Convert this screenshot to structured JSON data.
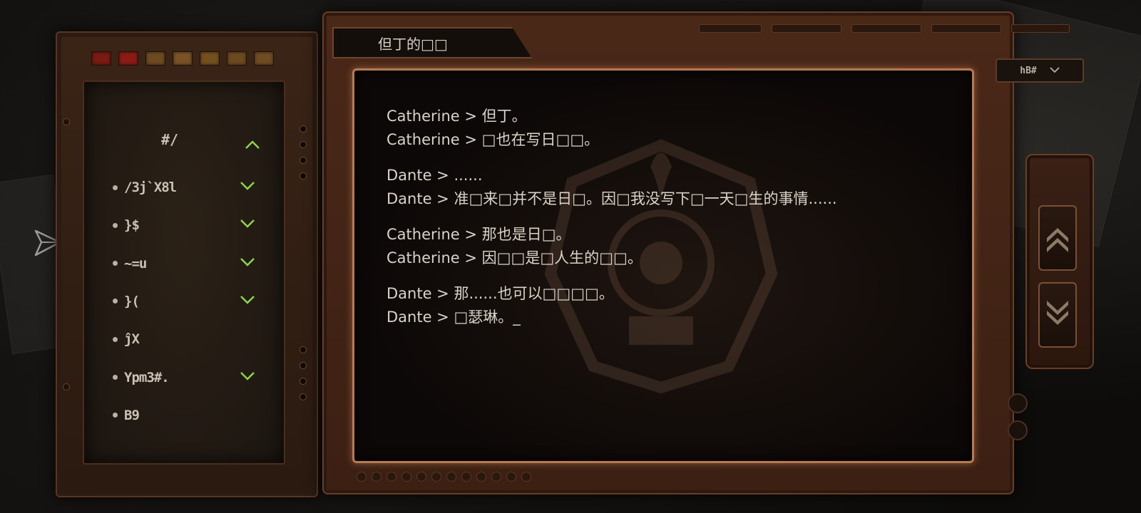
{
  "left_panel": {
    "header": "#/",
    "lights": [
      "#7a1a12",
      "#8a1c14",
      "#6e4a22",
      "#7a5226",
      "#74501f",
      "#6c4a20",
      "#6f4c22"
    ],
    "items": [
      {
        "label": "/3j`X8l",
        "has_chevron": true
      },
      {
        "label": "}$",
        "has_chevron": true
      },
      {
        "label": "~=u",
        "has_chevron": true
      },
      {
        "label": "}(",
        "has_chevron": true
      },
      {
        "label": "ĵX",
        "has_chevron": false
      },
      {
        "label": "Ypm3#.",
        "has_chevron": true
      },
      {
        "label": "B9",
        "has_chevron": false
      }
    ]
  },
  "main_panel": {
    "title": "但丁的□□",
    "dropdown_value": "hB#",
    "dialogue": [
      [
        "Catherine > 但丁。",
        "Catherine > □也在写日□□。"
      ],
      [
        "Dante > ......",
        "Dante > 准□来□并不是日□。因□我没写下□一天□生的事情......"
      ],
      [
        "Catherine > 那也是日□。",
        "Catherine > 因□□是□人生的□□。"
      ],
      [
        "Dante > 那......也可以□□□□。",
        "Dante > □瑟琳。_"
      ]
    ]
  },
  "colors": {
    "accent_green": "#8dd44a",
    "text": "#d9d2c6",
    "frame": "#6a3e24",
    "glow": "#b67a52"
  }
}
